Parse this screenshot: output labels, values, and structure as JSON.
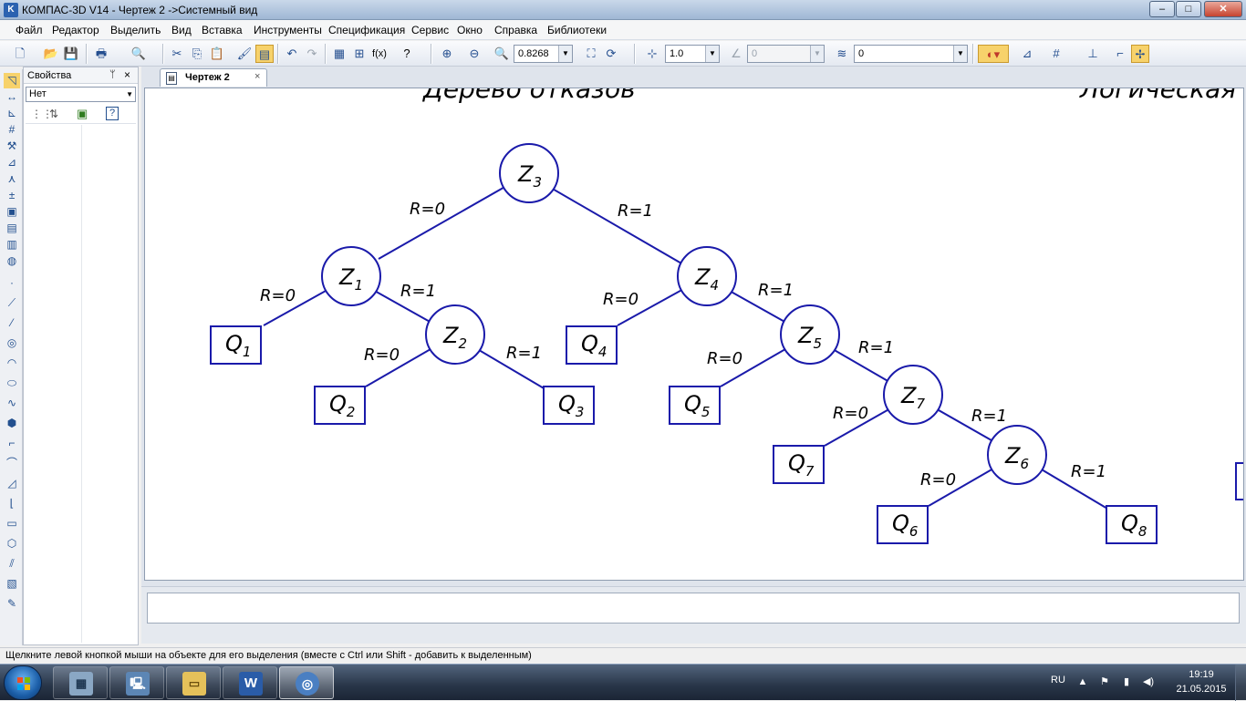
{
  "window": {
    "title": "КОМПАС-3D V14 - Чертеж 2 ->Системный вид",
    "app_icon": "K",
    "controls": {
      "minimize": "–",
      "maximize": "□",
      "close": "✕"
    }
  },
  "menu": [
    "Файл",
    "Редактор",
    "Выделить",
    "Вид",
    "Вставка",
    "Инструменты",
    "Спецификация",
    "Сервис",
    "Окно",
    "Справка",
    "Библиотеки"
  ],
  "toolbar": {
    "zoom_value": "0.8268",
    "step_value": "1.0",
    "angle_value": "0",
    "layer_value": "0",
    "icons": [
      "new-file-icon",
      "open-folder-icon",
      "save-icon",
      "print-icon",
      "preview-icon",
      "cut-icon",
      "copy-icon",
      "paste-icon",
      "format-brush-icon",
      "manager-icon",
      "undo-icon",
      "redo-icon",
      "tree-icon",
      "variables-icon",
      "fx-icon",
      "help-cursor-icon",
      "zoom-window-icon",
      "zoom-all-icon",
      "zoom-scale-icon",
      "refresh-icon",
      "snap-icon",
      "ortho-icon",
      "layers-icon",
      "magnet-icon",
      "grid-icon",
      "local-cs-icon",
      "round-icon",
      "snap-settings-icon"
    ]
  },
  "properties_panel": {
    "title": "Свойства",
    "pin": "ᛘ",
    "close": "×",
    "selection": "Нет",
    "help": "?"
  },
  "document_tab": {
    "label": "Чертеж 2",
    "close": "×"
  },
  "drawing": {
    "partial_headers": [
      "Дерево отказов",
      "Логическая"
    ],
    "nodes": [
      {
        "id": "Z3",
        "letter": "Z",
        "sub": "3"
      },
      {
        "id": "Z1",
        "letter": "Z",
        "sub": "1"
      },
      {
        "id": "Z4",
        "letter": "Z",
        "sub": "4"
      },
      {
        "id": "Z2",
        "letter": "Z",
        "sub": "2"
      },
      {
        "id": "Z5",
        "letter": "Z",
        "sub": "5"
      },
      {
        "id": "Z7",
        "letter": "Z",
        "sub": "7"
      },
      {
        "id": "Z6",
        "letter": "Z",
        "sub": "6"
      }
    ],
    "leaves": [
      {
        "id": "Q1",
        "letter": "Q",
        "sub": "1"
      },
      {
        "id": "Q2",
        "letter": "Q",
        "sub": "2"
      },
      {
        "id": "Q3",
        "letter": "Q",
        "sub": "3"
      },
      {
        "id": "Q4",
        "letter": "Q",
        "sub": "4"
      },
      {
        "id": "Q5",
        "letter": "Q",
        "sub": "5"
      },
      {
        "id": "Q7",
        "letter": "Q",
        "sub": "7"
      },
      {
        "id": "Q6",
        "letter": "Q",
        "sub": "6"
      },
      {
        "id": "Q8",
        "letter": "Q",
        "sub": "8"
      }
    ],
    "edge_labels": {
      "r0": "R=0",
      "r1": "R=1"
    },
    "line_color": "#1a1aaa"
  },
  "status": {
    "hint": "Щелкните левой кнопкой мыши на объекте для его выделения (вместе с Ctrl или Shift - добавить к выделенным)"
  },
  "taskbar": {
    "apps": [
      "calculator-icon",
      "computer-icon",
      "explorer-icon",
      "word-icon",
      "kompas-icon"
    ],
    "word_letter": "W",
    "language": "RU",
    "time": "19:19",
    "date": "21.05.2015"
  }
}
